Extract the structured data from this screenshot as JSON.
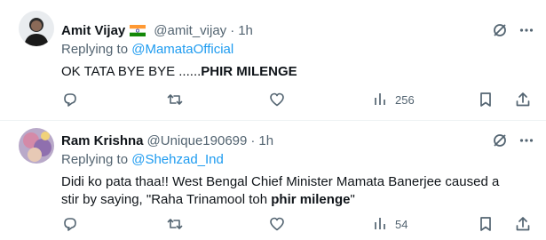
{
  "tweets": [
    {
      "name": "Amit Vijay",
      "has_flag": true,
      "handle": "@amit_vijay",
      "separator": "·",
      "time": "1h",
      "replying_prefix": "Replying to",
      "replying_to": "@MamataOfficial",
      "text_plain": "OK TATA BYE BYE ......",
      "text_bold": "PHIR MILENGE",
      "text_after": "",
      "views": "256",
      "icons": [
        "grok-icon",
        "more-icon",
        "reply-icon",
        "retweet-icon",
        "like-icon",
        "views-icon",
        "bookmark-icon",
        "share-icon"
      ]
    },
    {
      "name": "Ram Krishna",
      "has_flag": false,
      "handle": "@Unique190699",
      "separator": "·",
      "time": "1h",
      "replying_prefix": "Replying to",
      "replying_to": "@Shehzad_Ind",
      "text_line1": "Didi ko pata thaa!! West Bengal Chief Minister Mamata Banerjee caused a",
      "text_plain": "stir by saying, \"Raha Trinamool toh ",
      "text_bold": "phir milenge",
      "text_after": "\"",
      "views": "54",
      "icons": [
        "grok-icon",
        "more-icon",
        "reply-icon",
        "retweet-icon",
        "like-icon",
        "views-icon",
        "bookmark-icon",
        "share-icon"
      ]
    }
  ],
  "colors": {
    "link": "#1d9bf0",
    "secondary": "#536471",
    "text": "#0f1419",
    "divider": "#eff3f4"
  }
}
